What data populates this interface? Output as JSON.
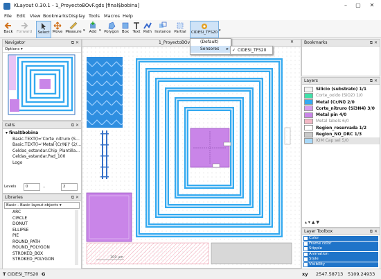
{
  "window": {
    "title": "KLayout 0.30.1 - 1_ProyectoBOvF.gds [final$bobina]"
  },
  "menu": [
    "File",
    "Edit",
    "View",
    "Bookmarks",
    "Display",
    "Tools",
    "Macros",
    "Help"
  ],
  "toolbar": {
    "back": "Back",
    "forward": "Forward",
    "select": "Select",
    "move": "Move",
    "measure": "Measure",
    "add": "Add",
    "polygon": "Polygon",
    "box": "Box",
    "text": "Text",
    "path": "Path",
    "instance": "Instance",
    "partial": "Partial",
    "tech": "CIDESI_TFS20"
  },
  "tech_menu": {
    "default": "(Default)",
    "sensores": "Sensores",
    "selected": "CIDESI_TFS20"
  },
  "navigator": {
    "title": "Navigator",
    "options": "Options"
  },
  "canvas": {
    "tab": "1_ProyectoBOvF.gds",
    "scale_label": "100 μm"
  },
  "cells": {
    "title": "Cells",
    "items": [
      "final$bobina",
      "Basic.TEXT(l='Corte_nitruro (S...",
      "Basic.TEXT(l='Metal (Cr/Ni)' (2/...",
      "Celdas_estandar.Chip_Plantilla...",
      "Celdas_estandar.Pad_100",
      "Logo"
    ],
    "levels_label": "Levels",
    "level_from": "0",
    "level_sep": "..",
    "level_to": "2"
  },
  "libraries": {
    "title": "Libraries",
    "selected": "Basic - Basic layout objects",
    "items": [
      "ARC",
      "CIRCLE",
      "DONUT",
      "ELLIPSE",
      "PIE",
      "ROUND_PATH",
      "ROUND_POLYGON",
      "STROKED_BOX",
      "STROKED_POLYGON"
    ]
  },
  "bookmarks": {
    "title": "Bookmarks"
  },
  "layers": {
    "title": "Layers",
    "items": [
      {
        "name": "Silicio (substrato) 1/1",
        "color": "#f4f4f4",
        "bold": true
      },
      {
        "name": "Corte_oxido (SiO2) 1/0",
        "color": "#3fe0a8",
        "bold": false
      },
      {
        "name": "Metal (Cr/Ni) 2/0",
        "color": "#35aaf0",
        "bold": true
      },
      {
        "name": "Corte_nitruro (Si3N4) 3/0",
        "color": "#d79cf0",
        "bold": true
      },
      {
        "name": "Metal pin 4/0",
        "color": "#c985e8",
        "bold": true
      },
      {
        "name": "Metal labels 6/0",
        "color": "#f3b8c5",
        "bold": false
      },
      {
        "name": "Region_reservada 1/2",
        "color": "#ffffff",
        "bold": true
      },
      {
        "name": "Region_NO_DRC 1/3",
        "color": "#c9c9c9",
        "bold": true
      },
      {
        "name": "IOM Cap sel 5/0",
        "color": "#a8d8f8",
        "bold": false
      }
    ]
  },
  "toolbox": {
    "title": "Layer Toolbox",
    "rows": [
      "Color",
      "Frame color",
      "Stipple",
      "Animation",
      "Style",
      "Visibility"
    ]
  },
  "status": {
    "tech": "CIDESI_TFS20",
    "mode": "G",
    "xy_label": "xy",
    "x": "2547.58713",
    "y": "5109.24933"
  },
  "colors": {
    "accent": "#1f74c9",
    "metal": "#35aaf0",
    "pin": "#c985e8"
  }
}
